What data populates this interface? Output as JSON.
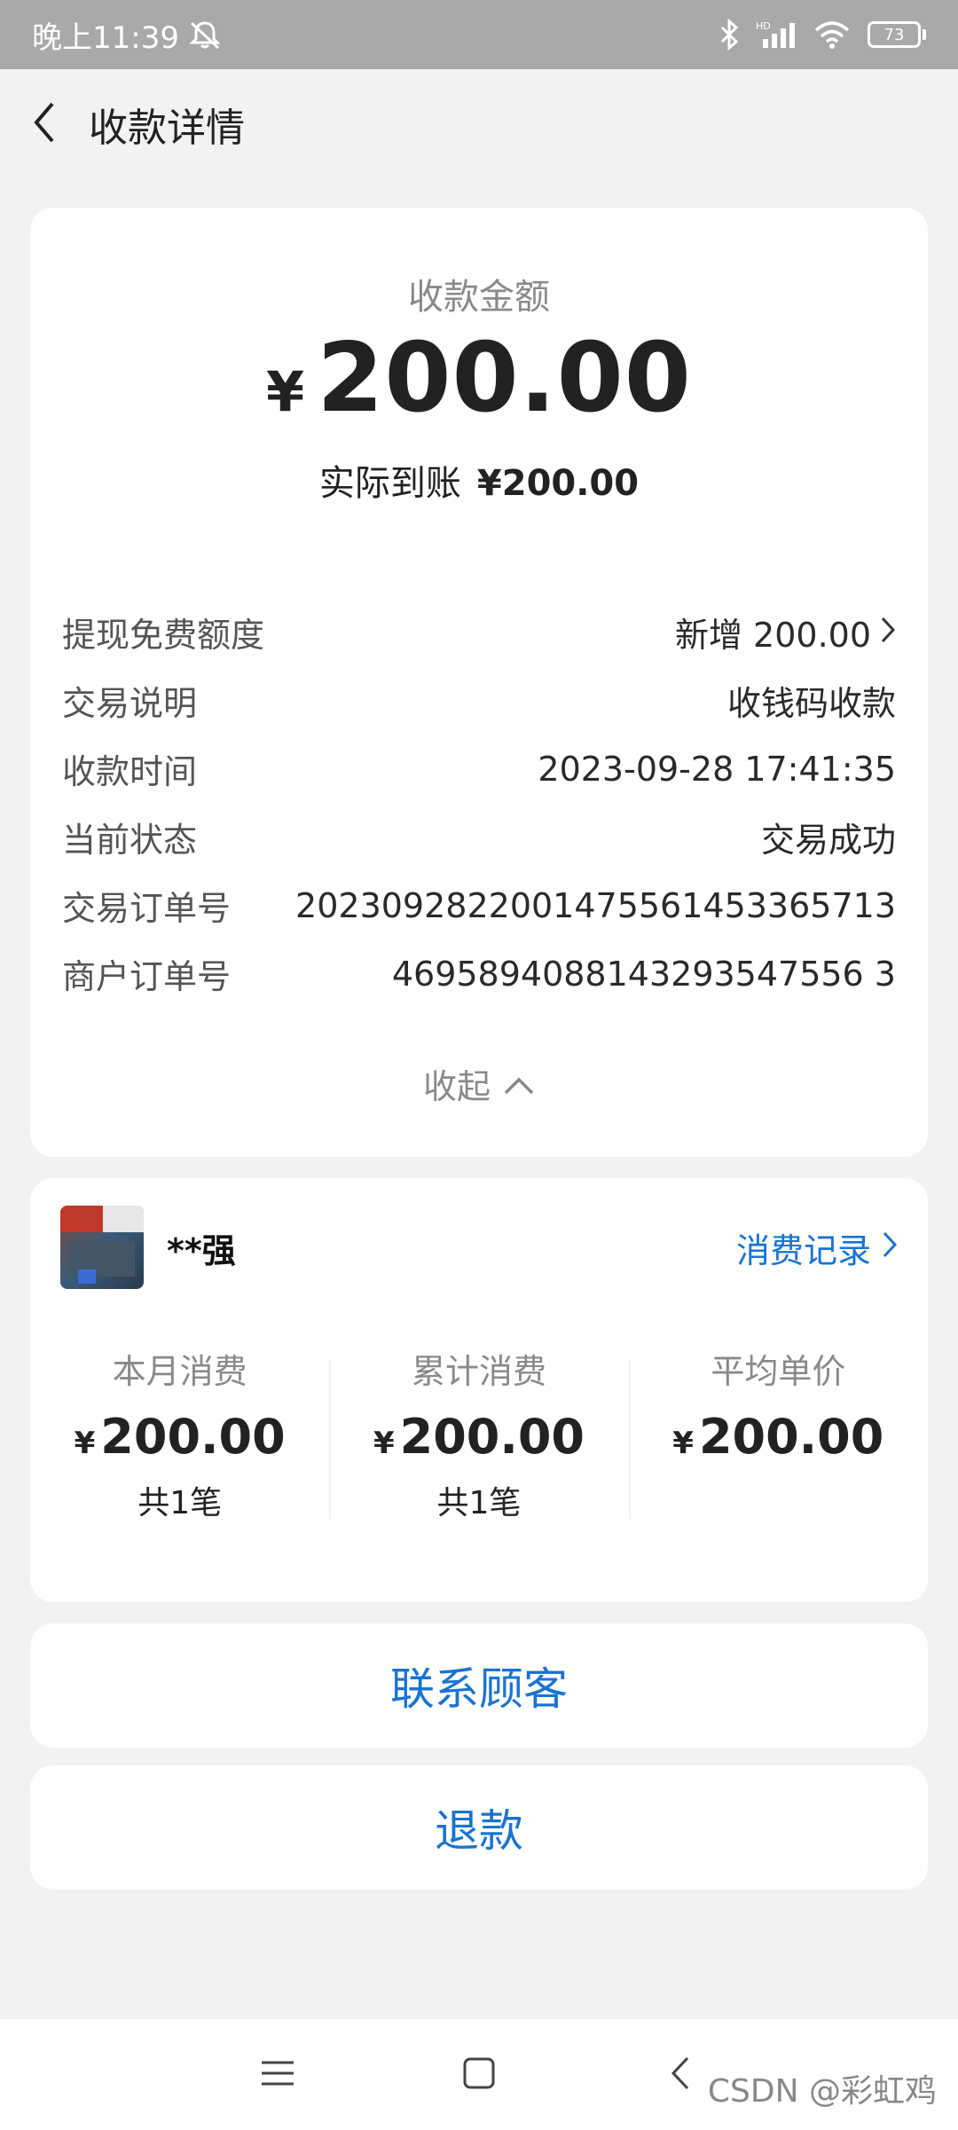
{
  "status_bar": {
    "time": "晚上11:39",
    "battery": "73",
    "signal_label": "HD"
  },
  "header": {
    "title": "收款详情"
  },
  "amount_card": {
    "label": "收款金额",
    "currency": "¥",
    "amount": "200.00",
    "actual_label": "实际到账",
    "actual_value": "¥200.00",
    "details": [
      {
        "label": "提现免费额度",
        "value": "新增 200.00",
        "has_arrow": true
      },
      {
        "label": "交易说明",
        "value": "收钱码收款"
      },
      {
        "label": "收款时间",
        "value": "2023-09-28 17:41:35"
      },
      {
        "label": "当前状态",
        "value": "交易成功"
      },
      {
        "label": "交易订单号",
        "value": "2023092822001475561453365713"
      },
      {
        "label": "商户订单号",
        "value": "4695894088143293547556 3"
      }
    ],
    "collapse_label": "收起"
  },
  "customer_card": {
    "name": "**强",
    "records_label": "消费记录",
    "stats": [
      {
        "label": "本月消费",
        "currency": "¥",
        "amount": "200.00",
        "count": "共1笔"
      },
      {
        "label": "累计消费",
        "currency": "¥",
        "amount": "200.00",
        "count": "共1笔"
      },
      {
        "label": "平均单价",
        "currency": "¥",
        "amount": "200.00",
        "count": ""
      }
    ]
  },
  "actions": {
    "contact_label": "联系顾客",
    "refund_label": "退款"
  },
  "watermark": "CSDN @彩虹鸡",
  "colors": {
    "accent": "#1a73d1",
    "background": "#f2f2f2",
    "status_bar": "#a9a9a9"
  }
}
